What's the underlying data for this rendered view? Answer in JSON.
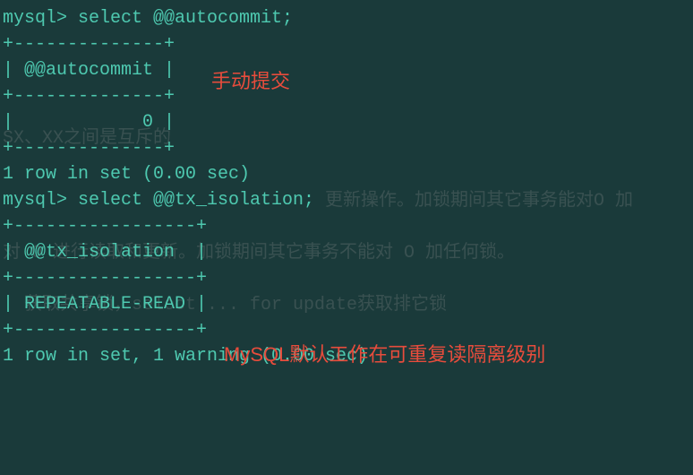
{
  "terminal": {
    "query1_prompt": "mysql> ",
    "query1_sql": "select @@autocommit;",
    "table1_sep": "+--------------+",
    "table1_header": "| @@autocommit |",
    "table1_value": "|            0 |",
    "result1": "1 row in set (0.00 sec)",
    "blank": "",
    "query2_prompt": "mysql> ",
    "query2_sql": "select @@tx_isolation;",
    "table2_sep": "+-----------------+",
    "table2_header": "| @@tx_isolation  |",
    "table2_value": "| REPEATABLE-READ |",
    "result2": "1 row in set, 1 warning (0.00 sec)"
  },
  "ghost": {
    "g1": "SX、XX之间是互斥的",
    "g2": "                              更新操作。加锁期间其它事务能对O 加",
    "g3": "对 O 进行读取和更新。加锁期间其它事务不能对 O 加任何锁。",
    "g4": "  获取共享锁，select ... for update获取排它锁"
  },
  "annotations": {
    "a1": "手动提交",
    "a2": "MySQL默认工作在可重复读隔离级别"
  }
}
